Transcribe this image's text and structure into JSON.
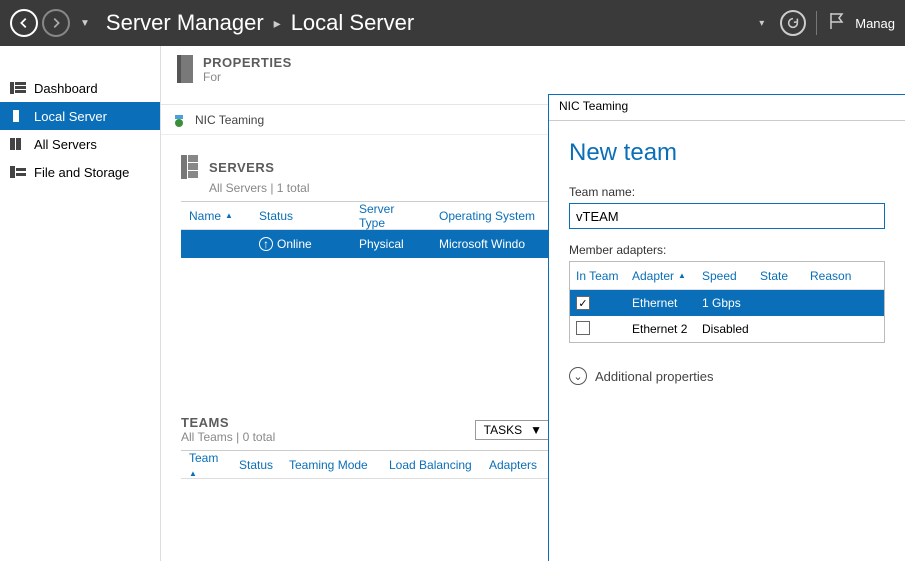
{
  "titlebar": {
    "crumb1": "Server Manager",
    "crumb2": "Local Server",
    "manage_label": "Manag"
  },
  "sidebar": {
    "items": [
      {
        "label": "Dashboard"
      },
      {
        "label": "Local Server"
      },
      {
        "label": "All Servers"
      },
      {
        "label": "File and Storage"
      }
    ]
  },
  "properties": {
    "title": "PROPERTIES",
    "for": "For"
  },
  "nic_window": {
    "title": "NIC Teaming",
    "servers_section": {
      "title": "SERVERS",
      "subtitle": "All Servers | 1 total",
      "columns": {
        "name": "Name",
        "status": "Status",
        "server_type": "Server Type",
        "os": "Operating System"
      },
      "rows": [
        {
          "name": "",
          "status": "Online",
          "server_type": "Physical",
          "os": "Microsoft Windo"
        }
      ]
    },
    "teams_section": {
      "title": "TEAMS",
      "subtitle": "All Teams | 0 total",
      "tasks_label": "TASKS",
      "columns": {
        "team": "Team",
        "status": "Status",
        "mode": "Teaming Mode",
        "lb": "Load Balancing",
        "adapters": "Adapters"
      }
    }
  },
  "new_team": {
    "window_title": "NIC Teaming",
    "heading": "New team",
    "team_name_label": "Team name:",
    "team_name_value": "vTEAM",
    "member_label": "Member adapters:",
    "columns": {
      "in_team": "In Team",
      "adapter": "Adapter",
      "speed": "Speed",
      "state": "State",
      "reason": "Reason"
    },
    "rows": [
      {
        "checked": true,
        "adapter": "Ethernet",
        "speed": "1 Gbps",
        "state": "",
        "reason": ""
      },
      {
        "checked": false,
        "adapter": "Ethernet 2",
        "speed": "Disabled",
        "state": "",
        "reason": ""
      }
    ],
    "additional_label": "Additional properties"
  }
}
